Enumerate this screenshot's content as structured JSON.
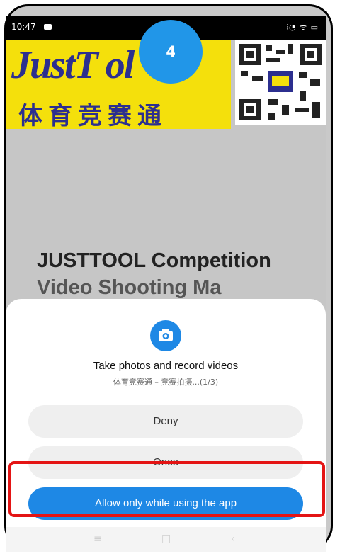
{
  "status_bar": {
    "time": "10:47",
    "icons": "⫶◔ ᯤ ▭"
  },
  "banner": {
    "logo_text": "JustT   ol",
    "chinese_text": "体育竞赛通"
  },
  "step_badge": "4",
  "background_title": {
    "line1": "JUSTTOOL Competition",
    "line2": "Video Shooting Ma"
  },
  "permission_dialog": {
    "icon": "camera-icon",
    "title": "Take photos and record videos",
    "subtitle": "体育竞赛通 – 竞赛拍摄...(1/3)",
    "deny_label": "Deny",
    "once_label": "Once",
    "allow_label": "Allow only while using the app"
  },
  "nav_bar": {
    "menu": "≡",
    "home": "□",
    "back": "‹"
  },
  "colors": {
    "accent": "#1e88e5",
    "highlight": "#e41414",
    "banner_yellow": "#f4e00c",
    "banner_blue": "#2c2f8f"
  }
}
